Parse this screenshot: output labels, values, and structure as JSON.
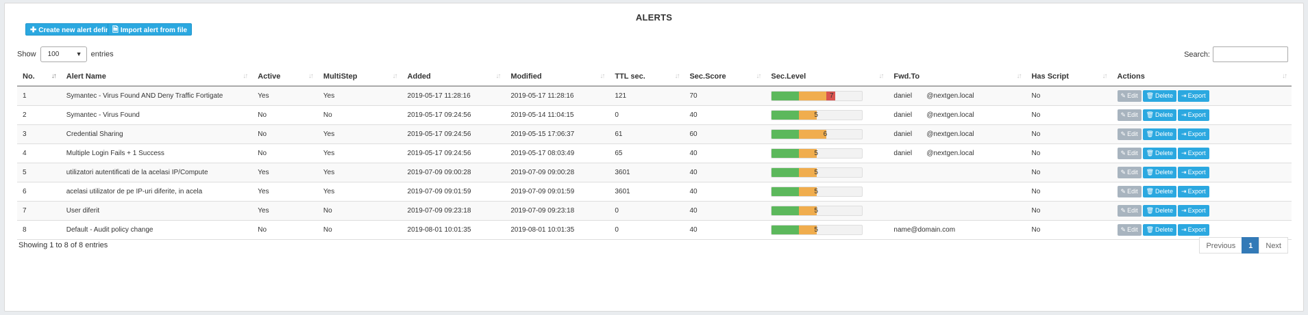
{
  "title": "ALERTS",
  "toolbar": {
    "create_label": "Create new alert definition",
    "import_label": "Import alert from file"
  },
  "length": {
    "show_label": "Show",
    "value": "100",
    "entries_label": "entries"
  },
  "search": {
    "label": "Search:",
    "value": ""
  },
  "columns": [
    "No.",
    "Alert Name",
    "Active",
    "MultiStep",
    "Added",
    "Modified",
    "TTL sec.",
    "Sec.Score",
    "Sec.Level",
    "Fwd.To",
    "Has Script",
    "Actions"
  ],
  "rows": [
    {
      "no": "1",
      "name": "Symantec - Virus Found AND Deny Traffic Fortigate",
      "active": "Yes",
      "multistep": "Yes",
      "added": "2019-05-17 11:28:16",
      "modified": "2019-05-17 11:28:16",
      "ttl": "121",
      "score": "70",
      "level": "7",
      "fwd_name": "daniel",
      "fwd_domain": "@nextgen.local",
      "fwd": "",
      "script": "No"
    },
    {
      "no": "2",
      "name": "Symantec - Virus Found",
      "active": "No",
      "multistep": "No",
      "added": "2019-05-17 09:24:56",
      "modified": "2019-05-14 11:04:15",
      "ttl": "0",
      "score": "40",
      "level": "5",
      "fwd_name": "daniel",
      "fwd_domain": "@nextgen.local",
      "fwd": "",
      "script": "No"
    },
    {
      "no": "3",
      "name": "Credential Sharing",
      "active": "No",
      "multistep": "Yes",
      "added": "2019-05-17 09:24:56",
      "modified": "2019-05-15 17:06:37",
      "ttl": "61",
      "score": "60",
      "level": "6",
      "fwd_name": "daniel",
      "fwd_domain": "@nextgen.local",
      "fwd": "",
      "script": "No"
    },
    {
      "no": "4",
      "name": "Multiple Login Fails + 1 Success",
      "active": "No",
      "multistep": "Yes",
      "added": "2019-05-17 09:24:56",
      "modified": "2019-05-17 08:03:49",
      "ttl": "65",
      "score": "40",
      "level": "5",
      "fwd_name": "daniel",
      "fwd_domain": "@nextgen.local",
      "fwd": "",
      "script": "No"
    },
    {
      "no": "5",
      "name": "utilizatori autentificati de la acelasi IP/Compute",
      "active": "Yes",
      "multistep": "Yes",
      "added": "2019-07-09 09:00:28",
      "modified": "2019-07-09 09:00:28",
      "ttl": "3601",
      "score": "40",
      "level": "5",
      "fwd_name": "",
      "fwd_domain": "",
      "fwd": "",
      "script": "No"
    },
    {
      "no": "6",
      "name": "acelasi utilizator de pe IP-uri diferite, in acela",
      "active": "Yes",
      "multistep": "Yes",
      "added": "2019-07-09 09:01:59",
      "modified": "2019-07-09 09:01:59",
      "ttl": "3601",
      "score": "40",
      "level": "5",
      "fwd_name": "",
      "fwd_domain": "",
      "fwd": "",
      "script": "No"
    },
    {
      "no": "7",
      "name": "User diferit",
      "active": "Yes",
      "multistep": "No",
      "added": "2019-07-09 09:23:18",
      "modified": "2019-07-09 09:23:18",
      "ttl": "0",
      "score": "40",
      "level": "5",
      "fwd_name": "",
      "fwd_domain": "",
      "fwd": "",
      "script": "No"
    },
    {
      "no": "8",
      "name": "Default - Audit policy change",
      "active": "No",
      "multistep": "No",
      "added": "2019-08-01 10:01:35",
      "modified": "2019-08-01 10:01:35",
      "ttl": "0",
      "score": "40",
      "level": "5",
      "fwd_name": "",
      "fwd_domain": "",
      "fwd": "name@domain.com",
      "script": "No"
    }
  ],
  "sec_level_max": 10,
  "level_colors": {
    "low": "#5cb85c",
    "mid": "#f0ad4e",
    "high": "#d9534f"
  },
  "actions": {
    "edit": "Edit",
    "delete": "Delete",
    "export": "Export"
  },
  "icons": {
    "create": "plus-icon",
    "import": "file-import-icon",
    "edit": "edit-icon",
    "delete": "trash-icon",
    "export": "export-icon",
    "sort": "sort-icon",
    "caret": "caret-down-icon"
  },
  "footer": {
    "info": "Showing 1 to 8 of 8 entries"
  },
  "pagination": {
    "previous": "Previous",
    "page": "1",
    "next": "Next"
  }
}
